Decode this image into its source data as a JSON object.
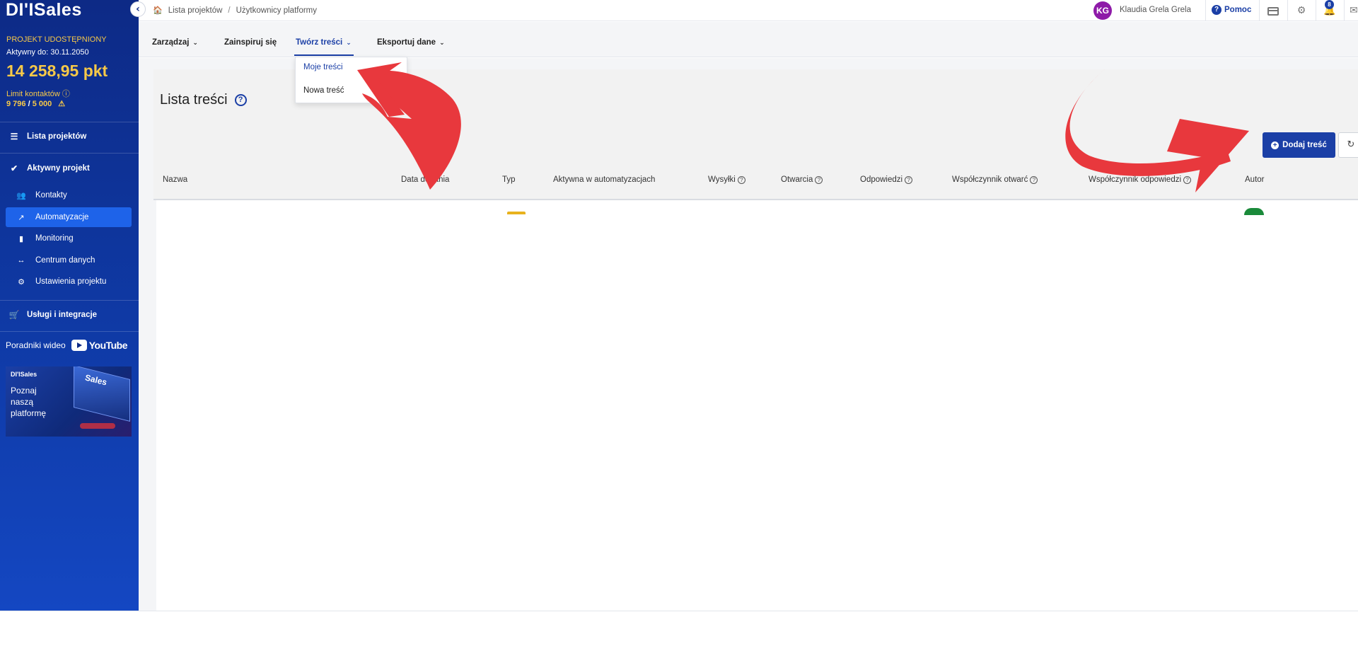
{
  "brand": {
    "logo": "DI'ISales",
    "collapse_glyph": "‹"
  },
  "project": {
    "status": "PROJEKT UDOSTĘPNIONY",
    "active_until": "Aktywny do: 30.11.2050",
    "points": "14 258,95 pkt",
    "limit_label": "Limit kontaktów ⓘ",
    "limit_used": "9 796",
    "limit_sep": " / ",
    "limit_total": "5 000",
    "limit_warning": "⚠"
  },
  "sidebar": {
    "projects_list": "Lista projektów",
    "active_project": "Aktywny projekt",
    "items": [
      {
        "label": "Kontakty",
        "icon": "contacts-icon",
        "active": false
      },
      {
        "label": "Automatyzacje",
        "icon": "automation-icon",
        "active": true
      },
      {
        "label": "Monitoring",
        "icon": "monitoring-icon",
        "active": false
      },
      {
        "label": "Centrum danych",
        "icon": "data-center-icon",
        "active": false
      },
      {
        "label": "Ustawienia projektu",
        "icon": "settings-icon",
        "active": false
      }
    ],
    "services": "Usługi i integracje",
    "videos_label": "Poradniki wideo",
    "youtube": "YouTube",
    "promo": {
      "brand": "DI'ISales",
      "text": "Poznaj naszą platformę",
      "screen_text": "Sales"
    }
  },
  "topbar": {
    "breadcrumb": [
      "Lista projektów",
      "Użytkownicy platformy"
    ],
    "user_initials": "KG",
    "user_name": "Klaudia Grela Grela",
    "help_label": "Pomoc",
    "notifications_count": "8",
    "avatar_color": "#8e1aa8"
  },
  "menu": {
    "items": [
      {
        "label": "Zarządzaj",
        "has_dropdown": true
      },
      {
        "label": "Zainspiruj się",
        "has_dropdown": false
      },
      {
        "label": "Twórz treści",
        "has_dropdown": true,
        "active": true
      },
      {
        "label": "Eksportuj dane",
        "has_dropdown": true
      }
    ],
    "dropdown": [
      "Moje treści",
      "Nowa treść"
    ]
  },
  "page": {
    "title": "Lista treści",
    "add_button": "Dodaj treść",
    "columns": [
      "Nazwa",
      "Data dodania",
      "Typ",
      "Aktywna w automatyzacjach",
      "Wysyłki",
      "Otwarcia",
      "Odpowiedzi",
      "Współczynnik otwarć",
      "Współczynnik odpowiedzi",
      "Autor"
    ]
  },
  "colors": {
    "sidebar_dark": "#0d2a86",
    "accent": "#1b3fa6",
    "active_item": "#1e63e9",
    "highlight_yellow": "#f7c948",
    "annotation_red": "#e8383d",
    "type_badge": "#e8b21d",
    "author_green": "#1a8a3a"
  }
}
